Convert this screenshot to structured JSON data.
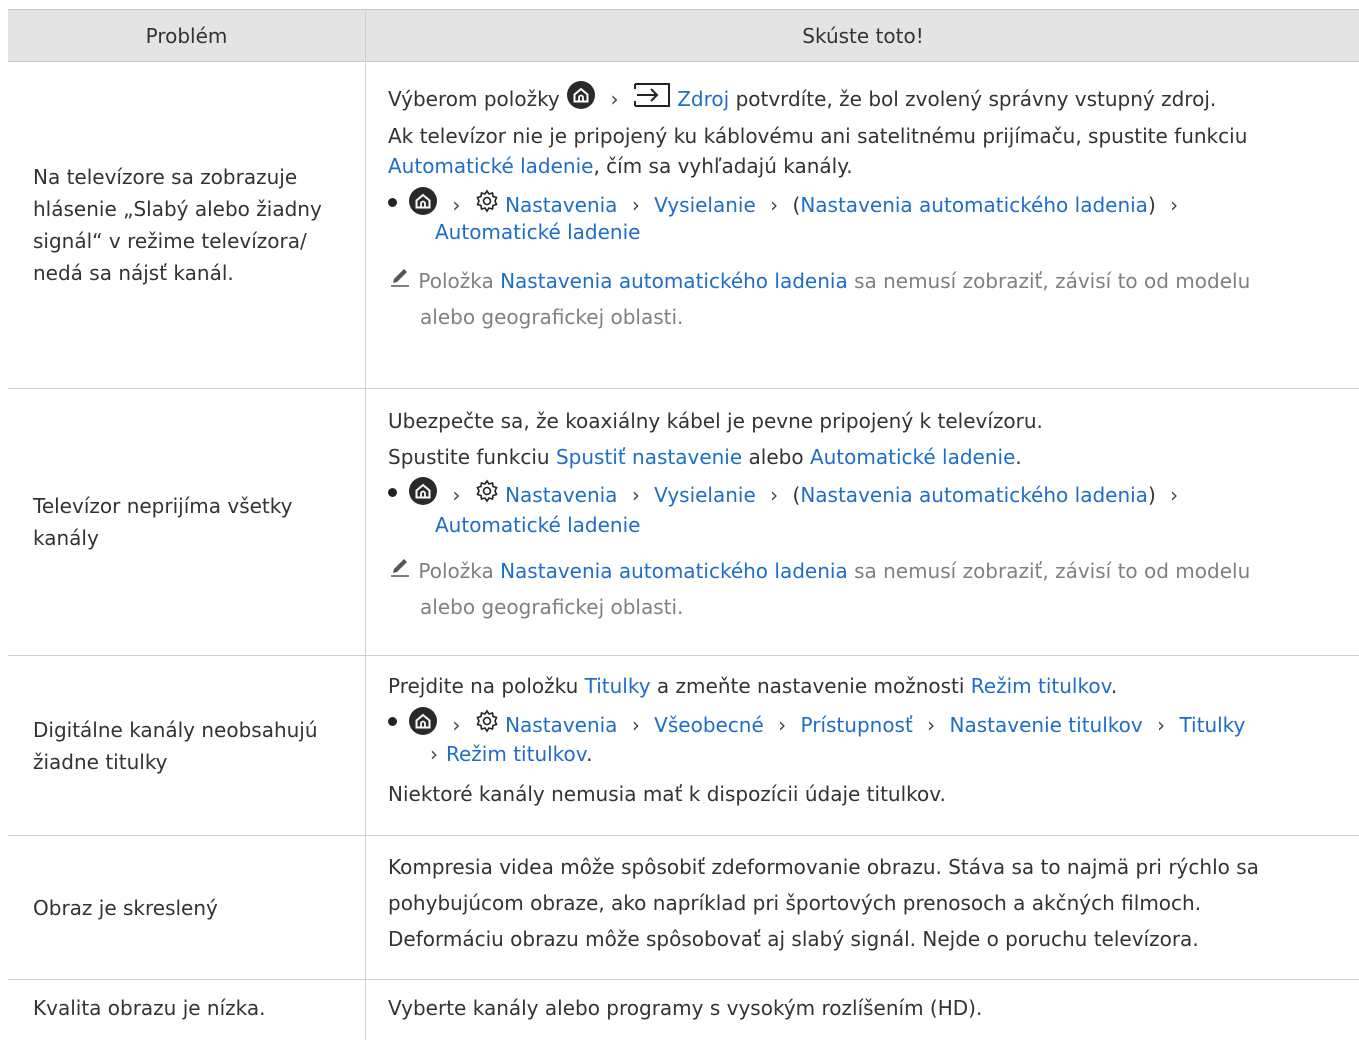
{
  "header": {
    "problem": "Problém",
    "solution": "Skúste toto!"
  },
  "rows": [
    {
      "problem": "Na televízore sa zobrazuje hlásenie „Slabý alebo žiadny signál“ v režime televízora/ nedá sa nájsť kanál.",
      "l1a": "Výberom položky",
      "l1b": "Zdroj",
      "l1c": "potvrdíte, že bol zvolený správny vstupný zdroj.",
      "l2": "Ak televízor nie je pripojený ku káblovému ani satelitnému prijímaču, spustite funkciu",
      "l3a": "Automatické ladenie",
      "l3b": ", čím sa vyhľadajú kanály.",
      "b1": "Nastavenia",
      "b2": "Vysielanie",
      "b3": "Nastavenia automatického ladenia",
      "b4": "Automatické ladenie",
      "n1": "Položka",
      "n2": "Nastavenia automatického ladenia",
      "n3": "sa nemusí zobraziť, závisí to od modelu",
      "n4": "alebo geografickej oblasti."
    },
    {
      "problem": "Televízor neprijíma všetky kanály",
      "l1": "Ubezpečte sa, že koaxiálny kábel je pevne pripojený k televízoru.",
      "l2a": "Spustite funkciu",
      "l2b": "Spustiť nastavenie",
      "l2c": "alebo",
      "l2d": "Automatické ladenie",
      "b1": "Nastavenia",
      "b2": "Vysielanie",
      "b3": "Nastavenia automatického ladenia",
      "b4": "Automatické ladenie",
      "n1": "Položka",
      "n2": "Nastavenia automatického ladenia",
      "n3": "sa nemusí zobraziť, závisí to od modelu",
      "n4": "alebo geografickej oblasti."
    },
    {
      "problem": "Digitálne kanály neobsahujú žiadne titulky",
      "l1a": "Prejdite na položku",
      "l1b": "Titulky",
      "l1c": "a zmeňte nastavenie možnosti",
      "l1d": "Režim titulkov",
      "b1": "Nastavenia",
      "b2": "Všeobecné",
      "b3": "Prístupnosť",
      "b4": "Nastavenie titulkov",
      "b5": "Titulky",
      "b6": "Režim titulkov",
      "l3": "Niektoré kanály nemusia mať k dispozícii údaje titulkov."
    },
    {
      "problem": "Obraz je skreslený",
      "l1": "Kompresia videa môže spôsobiť zdeformovanie obrazu. Stáva sa to najmä pri rýchlo sa",
      "l2": "pohybujúcom obraze, ako napríklad pri športových prenosoch a akčných filmoch.",
      "l3": "Deformáciu obrazu môže spôsobovať aj slabý signál. Nejde o poruchu televízora."
    },
    {
      "problem": "Kvalita obrazu je nízka.",
      "l1": "Vyberte kanály alebo programy s vysokým rozlíšením (HD)."
    }
  ],
  "colors": {
    "link": "#1e6ec8",
    "note": "#808080",
    "header_bg": "#e4e4e4",
    "border": "#cfcfcf"
  },
  "icons": [
    "home-icon",
    "source-icon",
    "gear-icon",
    "chevron-right-icon",
    "pencil-note-icon"
  ]
}
